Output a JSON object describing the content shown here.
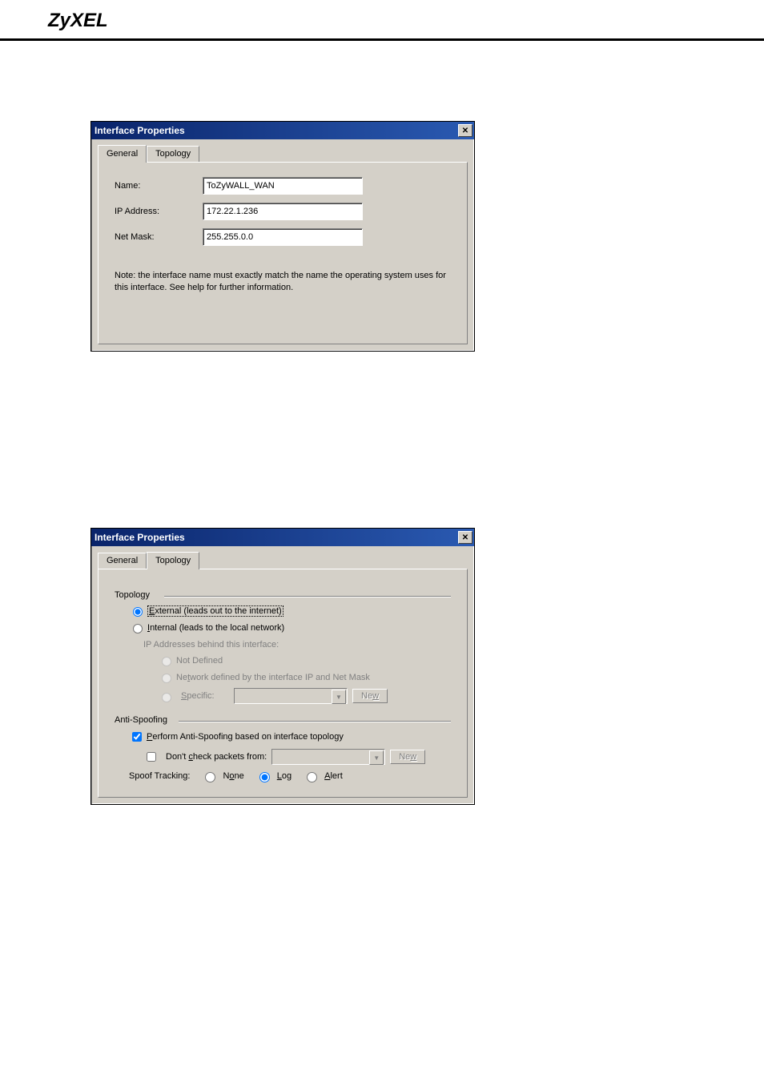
{
  "pageHeader": "ZyXEL",
  "dialog1": {
    "title": "Interface Properties",
    "tabs": {
      "general": "General",
      "topology": "Topology"
    },
    "labels": {
      "name": "Name:",
      "ip": "IP Address:",
      "mask": "Net Mask:"
    },
    "values": {
      "name": "ToZyWALL_WAN",
      "ip": "172.22.1.236",
      "mask": "255.255.0.0"
    },
    "note": "Note: the interface name must exactly match the name the operating system uses for this interface. See help for further information."
  },
  "dialog2": {
    "title": "Interface Properties",
    "tabs": {
      "general": "General",
      "topology": "Topology"
    },
    "topologyGroup": "Topology",
    "radioExternal": "External (leads out to the internet)",
    "radioInternal": "Internal (leads to the local network)",
    "ipBehindLabel": "IP Addresses behind this interface:",
    "radioNotDefined": "Not Defined",
    "radioNetworkDefined": "Network defined by the interface IP and Net Mask",
    "radioSpecific": "Specific:",
    "newBtn": "New",
    "antispoofGroup": "Anti-Spoofing",
    "performAntispoof": "Perform Anti-Spoofing based on interface topology",
    "dontCheck": "Don't check packets from:",
    "spoofTrackingLabel": "Spoof Tracking:",
    "spoofNone": "None",
    "spoofLog": "Log",
    "spoofAlert": "Alert"
  }
}
